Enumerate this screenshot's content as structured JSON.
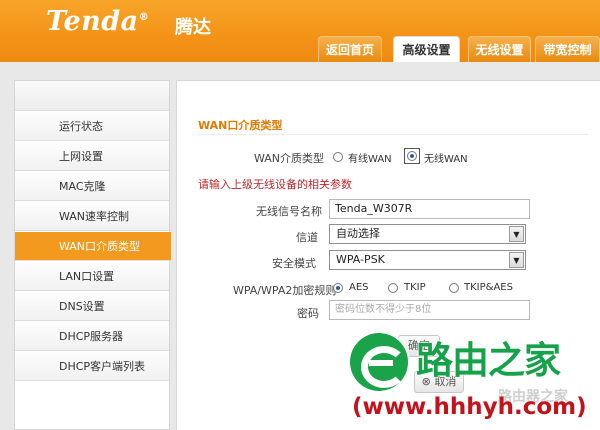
{
  "brand": {
    "logo": "Tenda",
    "logo_cn": "腾达"
  },
  "tabs": [
    {
      "label": "返回首页"
    },
    {
      "label": "高级设置"
    },
    {
      "label": "无线设置"
    },
    {
      "label": "带宽控制"
    }
  ],
  "sidebar": {
    "items": [
      {
        "label": "运行状态"
      },
      {
        "label": "上网设置"
      },
      {
        "label": "MAC克隆"
      },
      {
        "label": "WAN速率控制"
      },
      {
        "label": "WAN口介质类型"
      },
      {
        "label": "LAN口设置"
      },
      {
        "label": "DNS设置"
      },
      {
        "label": "DHCP服务器"
      },
      {
        "label": "DHCP客户端列表"
      }
    ],
    "active_index": 4
  },
  "main": {
    "section_title": "WAN口介质类型",
    "wan_type": {
      "label": "WAN介质类型",
      "options": [
        "有线WAN",
        "无线WAN"
      ],
      "selected": "无线WAN"
    },
    "hint": "请输入上级无线设备的相关参数",
    "ssid": {
      "label": "无线信号名称",
      "value": "Tenda_W307R"
    },
    "channel": {
      "label": "信道",
      "value": "自动选择"
    },
    "security": {
      "label": "安全模式",
      "value": "WPA-PSK"
    },
    "encryption": {
      "label": "WPA/WPA2加密规则",
      "options": [
        "AES",
        "TKIP",
        "TKIP&AES"
      ],
      "selected": "AES"
    },
    "password": {
      "label": "密码",
      "placeholder": "密码位数不得少于8位"
    },
    "buttons": {
      "ok": "确定",
      "cancel": "取消"
    }
  },
  "watermark": {
    "cn": "路由之家",
    "url": "(www.hhhyh.com)",
    "ghost": "路由器之家"
  },
  "colors": {
    "brand_orange": "#f39418",
    "active_item": "#f39a1e",
    "hint_red": "#c0272d",
    "watermark_green": "#16a14a",
    "watermark_red": "#c4121a"
  }
}
